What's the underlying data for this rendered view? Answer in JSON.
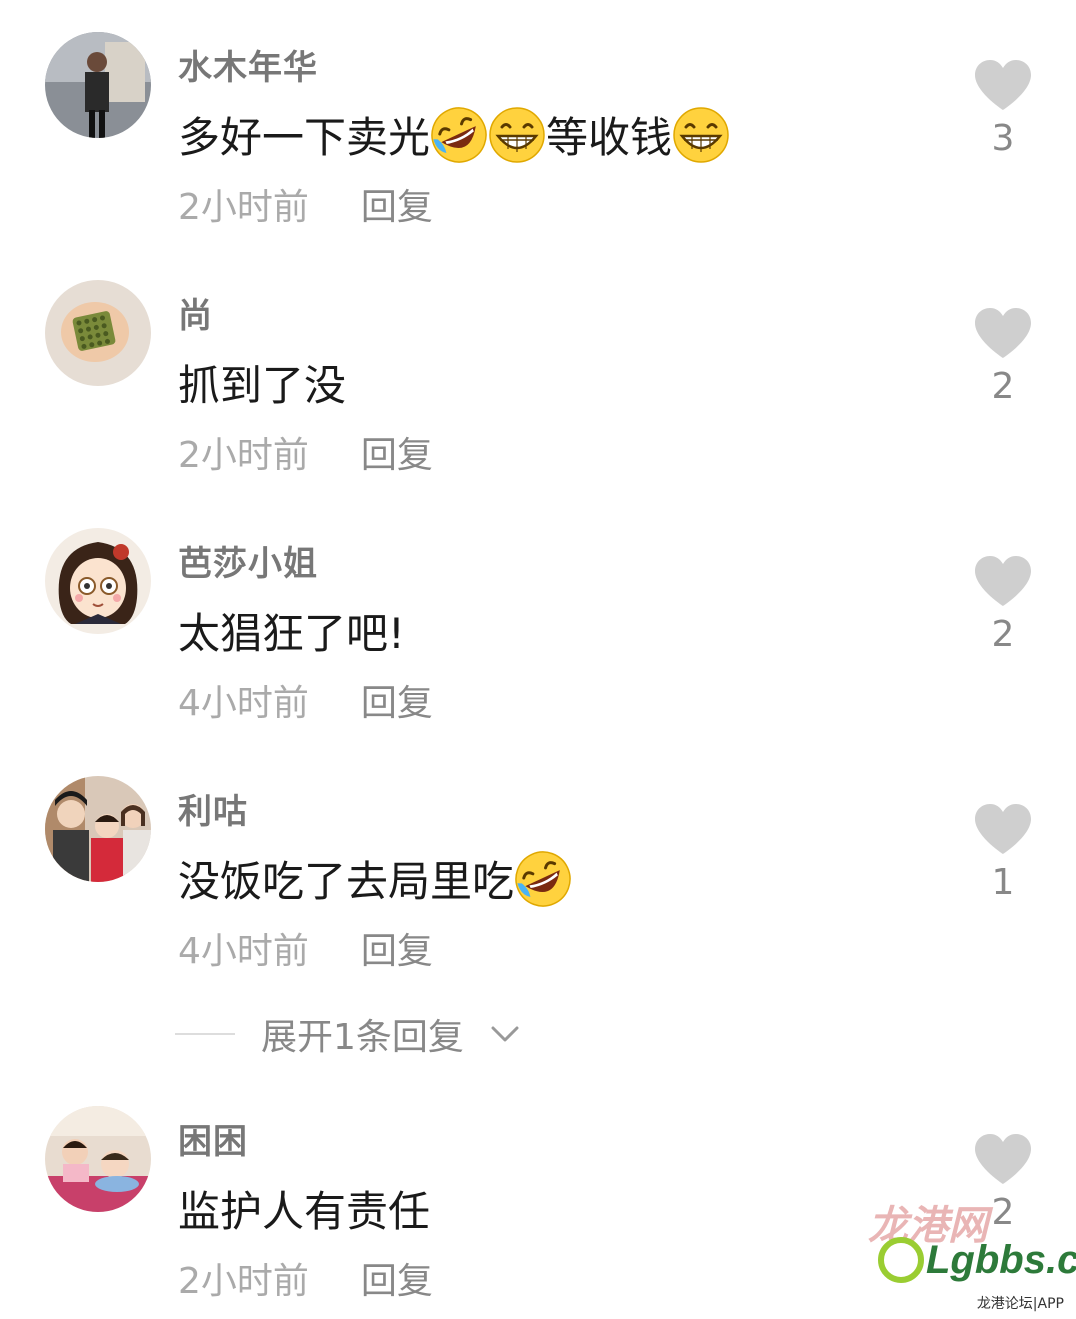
{
  "comments": [
    {
      "username": "水木年华",
      "text": "多好一下卖光",
      "text_after_emoji": "等收钱",
      "time": "2小时前",
      "reply": "回复",
      "likes": "3"
    },
    {
      "username": "尚",
      "text": "抓到了没",
      "time": "2小时前",
      "reply": "回复",
      "likes": "2"
    },
    {
      "username": "芭莎小姐",
      "text": "太猖狂了吧!",
      "time": "4小时前",
      "reply": "回复",
      "likes": "2"
    },
    {
      "username": "利咕",
      "text": "没饭吃了去局里吃",
      "time": "4小时前",
      "reply": "回复",
      "likes": "1"
    },
    {
      "username": "困困",
      "text": "监护人有责任",
      "time": "2小时前",
      "reply": "回复",
      "likes": "2"
    }
  ],
  "expand_replies": "展开1条回复",
  "watermark": {
    "script_text": "龙港网",
    "logo_text": "Lgbbs.cn",
    "sub_text": "龙港论坛|APP"
  },
  "colors": {
    "like_icon": "#cfcfcf",
    "username": "#777777",
    "meta": "#aaaaaa",
    "logo_green": "#2d7a3a"
  },
  "icons": {
    "like": "heart-icon",
    "expand": "chevron-down-icon",
    "emoji_1": "rolling-laughing-emoji",
    "emoji_2": "grinning-emoji"
  }
}
